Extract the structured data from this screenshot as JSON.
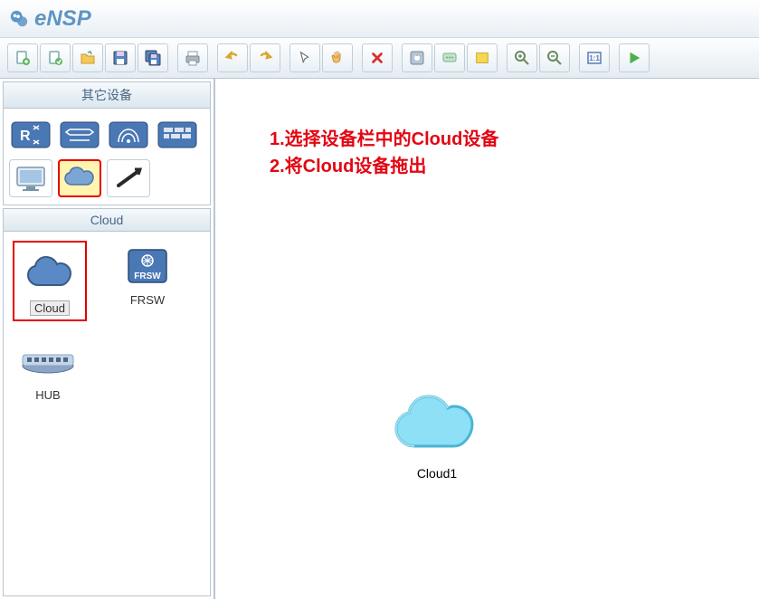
{
  "app": {
    "title": "eNSP"
  },
  "toolbar": {
    "buttons": [
      "new-file",
      "open-file",
      "folder-open",
      "save",
      "save-all",
      "print",
      "undo",
      "redo",
      "select",
      "pan",
      "delete",
      "config",
      "comment",
      "rectangle",
      "zoom-in",
      "zoom-out",
      "fit",
      "start"
    ]
  },
  "sidebar": {
    "categories_title": "其它设备",
    "devices_title": "Cloud",
    "devices": {
      "cloud": "Cloud",
      "frsw": "FRSW",
      "hub": "HUB"
    }
  },
  "canvas": {
    "annotation_line1": "1.选择设备栏中的Cloud设备",
    "annotation_line2": "2.将Cloud设备拖出",
    "device1_label": "Cloud1"
  }
}
